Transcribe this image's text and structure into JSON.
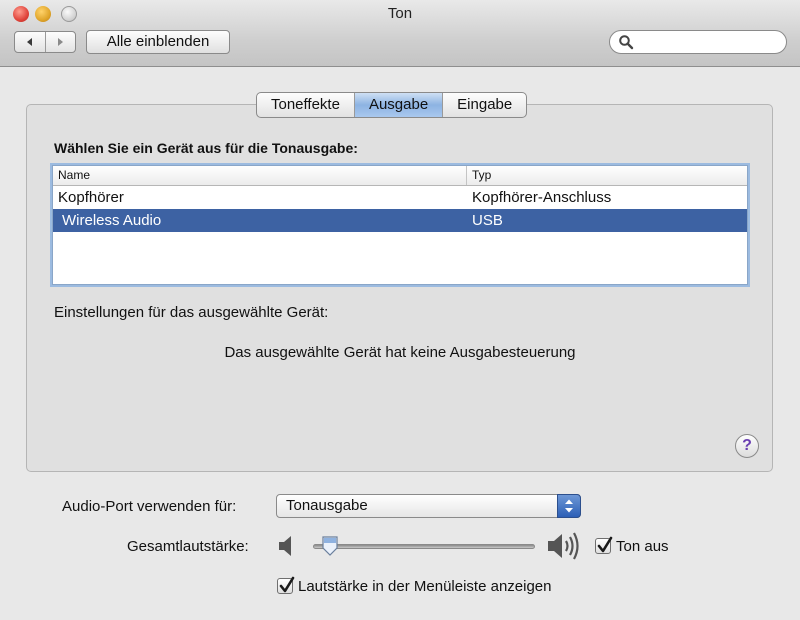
{
  "window": {
    "title": "Ton",
    "show_all_label": "Alle einblenden",
    "nav_back_icon": "back-arrow-icon",
    "nav_forward_icon": "forward-arrow-icon",
    "search": {
      "value": "",
      "icon": "search-icon"
    }
  },
  "tabs": [
    {
      "label": "Toneffekte",
      "active": false
    },
    {
      "label": "Ausgabe",
      "active": true
    },
    {
      "label": "Eingabe",
      "active": false
    }
  ],
  "output": {
    "heading": "Wählen Sie ein Gerät aus für die Tonausgabe:",
    "columns": {
      "name": "Name",
      "type": "Typ"
    },
    "devices": [
      {
        "name": "Kopfhörer",
        "type": "Kopfhörer-Anschluss",
        "selected": false
      },
      {
        "name": "Wireless Audio",
        "type": "USB",
        "selected": true
      }
    ],
    "settings_label": "Einstellungen für das ausgewählte Gerät:",
    "no_control_text": "Das ausgewählte Gerät hat keine Ausgabesteuerung",
    "help_label": "?"
  },
  "bottom": {
    "port_label": "Audio-Port verwenden für:",
    "port_value": "Tonausgabe",
    "volume_label": "Gesamtlautstärke:",
    "volume_level": 0.04,
    "mute_label": "Ton aus",
    "mute_checked": true,
    "menubar_label": "Lautstärke in der Menüleiste anzeigen",
    "menubar_checked": true
  },
  "colors": {
    "selection": "#3d62a3",
    "tab_active": "#8db3e2",
    "help_mark": "#6a3fb1"
  }
}
